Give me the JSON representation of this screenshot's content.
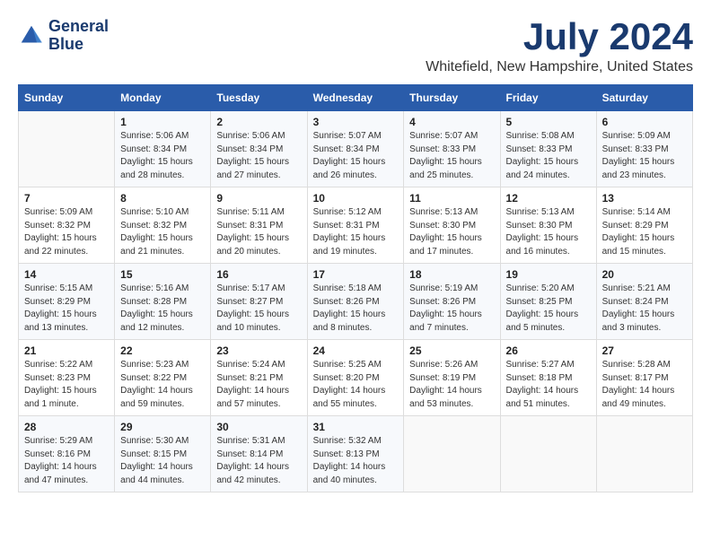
{
  "header": {
    "logo_line1": "General",
    "logo_line2": "Blue",
    "month_year": "July 2024",
    "location": "Whitefield, New Hampshire, United States"
  },
  "calendar": {
    "headers": [
      "Sunday",
      "Monday",
      "Tuesday",
      "Wednesday",
      "Thursday",
      "Friday",
      "Saturday"
    ],
    "weeks": [
      [
        {
          "day": "",
          "info": ""
        },
        {
          "day": "1",
          "info": "Sunrise: 5:06 AM\nSunset: 8:34 PM\nDaylight: 15 hours\nand 28 minutes."
        },
        {
          "day": "2",
          "info": "Sunrise: 5:06 AM\nSunset: 8:34 PM\nDaylight: 15 hours\nand 27 minutes."
        },
        {
          "day": "3",
          "info": "Sunrise: 5:07 AM\nSunset: 8:34 PM\nDaylight: 15 hours\nand 26 minutes."
        },
        {
          "day": "4",
          "info": "Sunrise: 5:07 AM\nSunset: 8:33 PM\nDaylight: 15 hours\nand 25 minutes."
        },
        {
          "day": "5",
          "info": "Sunrise: 5:08 AM\nSunset: 8:33 PM\nDaylight: 15 hours\nand 24 minutes."
        },
        {
          "day": "6",
          "info": "Sunrise: 5:09 AM\nSunset: 8:33 PM\nDaylight: 15 hours\nand 23 minutes."
        }
      ],
      [
        {
          "day": "7",
          "info": "Sunrise: 5:09 AM\nSunset: 8:32 PM\nDaylight: 15 hours\nand 22 minutes."
        },
        {
          "day": "8",
          "info": "Sunrise: 5:10 AM\nSunset: 8:32 PM\nDaylight: 15 hours\nand 21 minutes."
        },
        {
          "day": "9",
          "info": "Sunrise: 5:11 AM\nSunset: 8:31 PM\nDaylight: 15 hours\nand 20 minutes."
        },
        {
          "day": "10",
          "info": "Sunrise: 5:12 AM\nSunset: 8:31 PM\nDaylight: 15 hours\nand 19 minutes."
        },
        {
          "day": "11",
          "info": "Sunrise: 5:13 AM\nSunset: 8:30 PM\nDaylight: 15 hours\nand 17 minutes."
        },
        {
          "day": "12",
          "info": "Sunrise: 5:13 AM\nSunset: 8:30 PM\nDaylight: 15 hours\nand 16 minutes."
        },
        {
          "day": "13",
          "info": "Sunrise: 5:14 AM\nSunset: 8:29 PM\nDaylight: 15 hours\nand 15 minutes."
        }
      ],
      [
        {
          "day": "14",
          "info": "Sunrise: 5:15 AM\nSunset: 8:29 PM\nDaylight: 15 hours\nand 13 minutes."
        },
        {
          "day": "15",
          "info": "Sunrise: 5:16 AM\nSunset: 8:28 PM\nDaylight: 15 hours\nand 12 minutes."
        },
        {
          "day": "16",
          "info": "Sunrise: 5:17 AM\nSunset: 8:27 PM\nDaylight: 15 hours\nand 10 minutes."
        },
        {
          "day": "17",
          "info": "Sunrise: 5:18 AM\nSunset: 8:26 PM\nDaylight: 15 hours\nand 8 minutes."
        },
        {
          "day": "18",
          "info": "Sunrise: 5:19 AM\nSunset: 8:26 PM\nDaylight: 15 hours\nand 7 minutes."
        },
        {
          "day": "19",
          "info": "Sunrise: 5:20 AM\nSunset: 8:25 PM\nDaylight: 15 hours\nand 5 minutes."
        },
        {
          "day": "20",
          "info": "Sunrise: 5:21 AM\nSunset: 8:24 PM\nDaylight: 15 hours\nand 3 minutes."
        }
      ],
      [
        {
          "day": "21",
          "info": "Sunrise: 5:22 AM\nSunset: 8:23 PM\nDaylight: 15 hours\nand 1 minute."
        },
        {
          "day": "22",
          "info": "Sunrise: 5:23 AM\nSunset: 8:22 PM\nDaylight: 14 hours\nand 59 minutes."
        },
        {
          "day": "23",
          "info": "Sunrise: 5:24 AM\nSunset: 8:21 PM\nDaylight: 14 hours\nand 57 minutes."
        },
        {
          "day": "24",
          "info": "Sunrise: 5:25 AM\nSunset: 8:20 PM\nDaylight: 14 hours\nand 55 minutes."
        },
        {
          "day": "25",
          "info": "Sunrise: 5:26 AM\nSunset: 8:19 PM\nDaylight: 14 hours\nand 53 minutes."
        },
        {
          "day": "26",
          "info": "Sunrise: 5:27 AM\nSunset: 8:18 PM\nDaylight: 14 hours\nand 51 minutes."
        },
        {
          "day": "27",
          "info": "Sunrise: 5:28 AM\nSunset: 8:17 PM\nDaylight: 14 hours\nand 49 minutes."
        }
      ],
      [
        {
          "day": "28",
          "info": "Sunrise: 5:29 AM\nSunset: 8:16 PM\nDaylight: 14 hours\nand 47 minutes."
        },
        {
          "day": "29",
          "info": "Sunrise: 5:30 AM\nSunset: 8:15 PM\nDaylight: 14 hours\nand 44 minutes."
        },
        {
          "day": "30",
          "info": "Sunrise: 5:31 AM\nSunset: 8:14 PM\nDaylight: 14 hours\nand 42 minutes."
        },
        {
          "day": "31",
          "info": "Sunrise: 5:32 AM\nSunset: 8:13 PM\nDaylight: 14 hours\nand 40 minutes."
        },
        {
          "day": "",
          "info": ""
        },
        {
          "day": "",
          "info": ""
        },
        {
          "day": "",
          "info": ""
        }
      ]
    ]
  }
}
